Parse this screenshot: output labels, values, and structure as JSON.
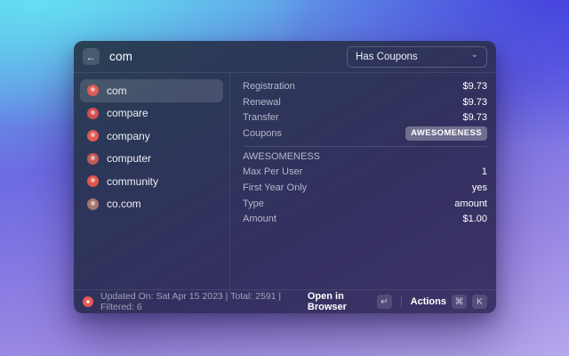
{
  "window": {
    "header": {
      "back_icon": "←",
      "search_value": "com",
      "dropdown": {
        "value": "Has Coupons",
        "chevron_icon": "⌄"
      }
    },
    "sidebar": {
      "items": [
        {
          "label": "com",
          "selected": true,
          "icon_color": "#d95b58"
        },
        {
          "label": "compare",
          "selected": false,
          "icon_color": "#d44f4f"
        },
        {
          "label": "company",
          "selected": false,
          "icon_color": "#e05a52"
        },
        {
          "label": "computer",
          "selected": false,
          "icon_color": "#c45a55"
        },
        {
          "label": "community",
          "selected": false,
          "icon_color": "#e0564e"
        },
        {
          "label": "co.com",
          "selected": false,
          "icon_color": "#a8766e"
        }
      ]
    },
    "detail": {
      "rows": [
        {
          "label": "Registration",
          "value": "$9.73",
          "badge": false
        },
        {
          "label": "Renewal",
          "value": "$9.73",
          "badge": false
        },
        {
          "label": "Transfer",
          "value": "$9.73",
          "badge": false
        },
        {
          "label": "Coupons",
          "value": "AWESOMENESS",
          "badge": true
        }
      ],
      "section": {
        "title": "AWESOMENESS",
        "rows": [
          {
            "label": "Max Per User",
            "value": "1",
            "badge": false
          },
          {
            "label": "First Year Only",
            "value": "yes",
            "badge": false
          },
          {
            "label": "Type",
            "value": "amount",
            "badge": false
          },
          {
            "label": "Amount",
            "value": "$1.00",
            "badge": false
          }
        ]
      }
    },
    "footer": {
      "status": "Updated On: Sat Apr 15 2023 | Total: 2591 | Filtered: 6",
      "primary_action": {
        "label": "Open in Browser",
        "key": "↵"
      },
      "secondary_action": {
        "label": "Actions",
        "keys": [
          "⌘",
          "K"
        ]
      }
    }
  },
  "colors": {
    "extension_icon": "#e25c54",
    "selected_row_bg": "rgba(255,255,255,0.13)",
    "badge_bg": "rgba(255,255,255,0.30)",
    "background_top_left": "#67e3f2",
    "background_top_right": "#4340dd",
    "background_bottom": "#b6a7ec"
  }
}
